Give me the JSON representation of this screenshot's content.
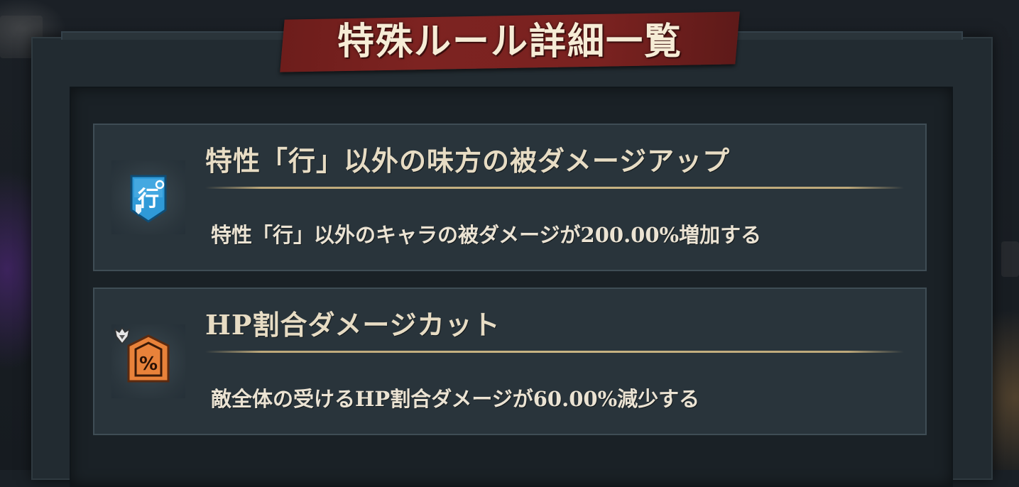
{
  "dialog": {
    "title": "特殊ルール詳細一覧"
  },
  "rules": [
    {
      "title": "特性「行」以外の味方の被ダメージアップ",
      "description": "特性「行」以外のキャラの被ダメージが200.00%増加する",
      "icon": "shield-gyo-icon",
      "icon_color": "#2f9ad8",
      "icon_text": "行"
    },
    {
      "title": "HP割合ダメージカット",
      "description": "敵全体の受けるHP割合ダメージが60.00%減少する",
      "icon": "shield-percent-icon",
      "icon_color": "#e8823a",
      "icon_text": "%"
    }
  ],
  "colors": {
    "banner": "#7a2220",
    "title_text": "#f6ecd6",
    "card_bg": "#29343b",
    "divider": "#c8b483"
  }
}
